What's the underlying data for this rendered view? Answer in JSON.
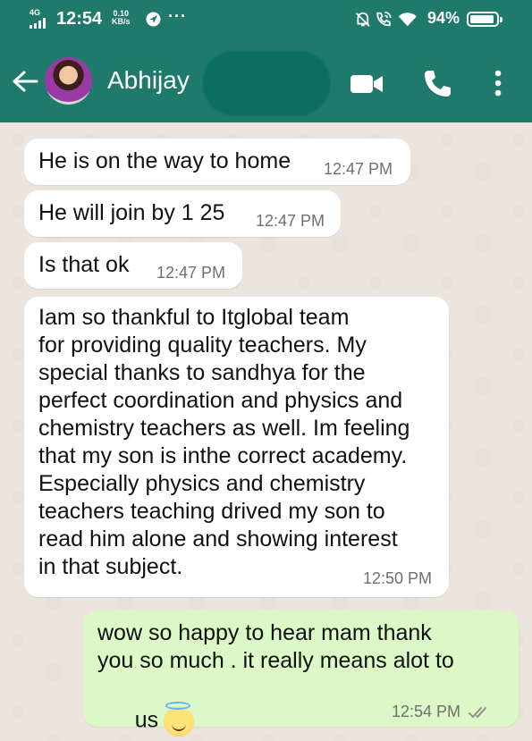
{
  "status_bar": {
    "network": "4G",
    "time": "12:54",
    "speed_value": "0.10",
    "speed_unit": "KB/s",
    "overflow": "···",
    "battery_percent": "94%",
    "battery_level": 0.94
  },
  "header": {
    "contact_name": "Abhijay",
    "icons": [
      "back-arrow-icon",
      "video-call-icon",
      "voice-call-icon",
      "more-options-icon"
    ]
  },
  "colors": {
    "header": "#1f7a6b",
    "chat_background": "#ece5dd",
    "incoming_bubble": "#ffffff",
    "outgoing_bubble": "#dcf8c6",
    "timestamp": "#6f6f6f",
    "read_ticks": "#8a8a8a"
  },
  "messages": [
    {
      "direction": "incoming",
      "text": "He is on the way to home",
      "time": "12:47 PM"
    },
    {
      "direction": "incoming",
      "text": "He will join by 1 25",
      "time": "12:47 PM"
    },
    {
      "direction": "incoming",
      "text": "Is that ok",
      "time": "12:47 PM"
    },
    {
      "direction": "incoming",
      "lines": [
        "Iam so thankful to Itglobal team",
        "for providing quality teachers. My",
        "special thanks to sandhya for the",
        "perfect coordination and physics and",
        "chemistry teachers as well. Im feeling",
        "that my son is inthe correct academy.",
        "Especially physics and chemistry",
        "teachers teaching drived my son to",
        "read him alone and showing interest",
        "in that subject."
      ],
      "time": "12:50 PM"
    },
    {
      "direction": "outgoing",
      "lines": [
        "wow so happy to hear mam thank",
        "you so much . it really means alot to",
        "us"
      ],
      "emoji": "smiling-face-with-halo-emoji",
      "time": "12:54 PM",
      "status": "read-double-tick-icon"
    }
  ]
}
